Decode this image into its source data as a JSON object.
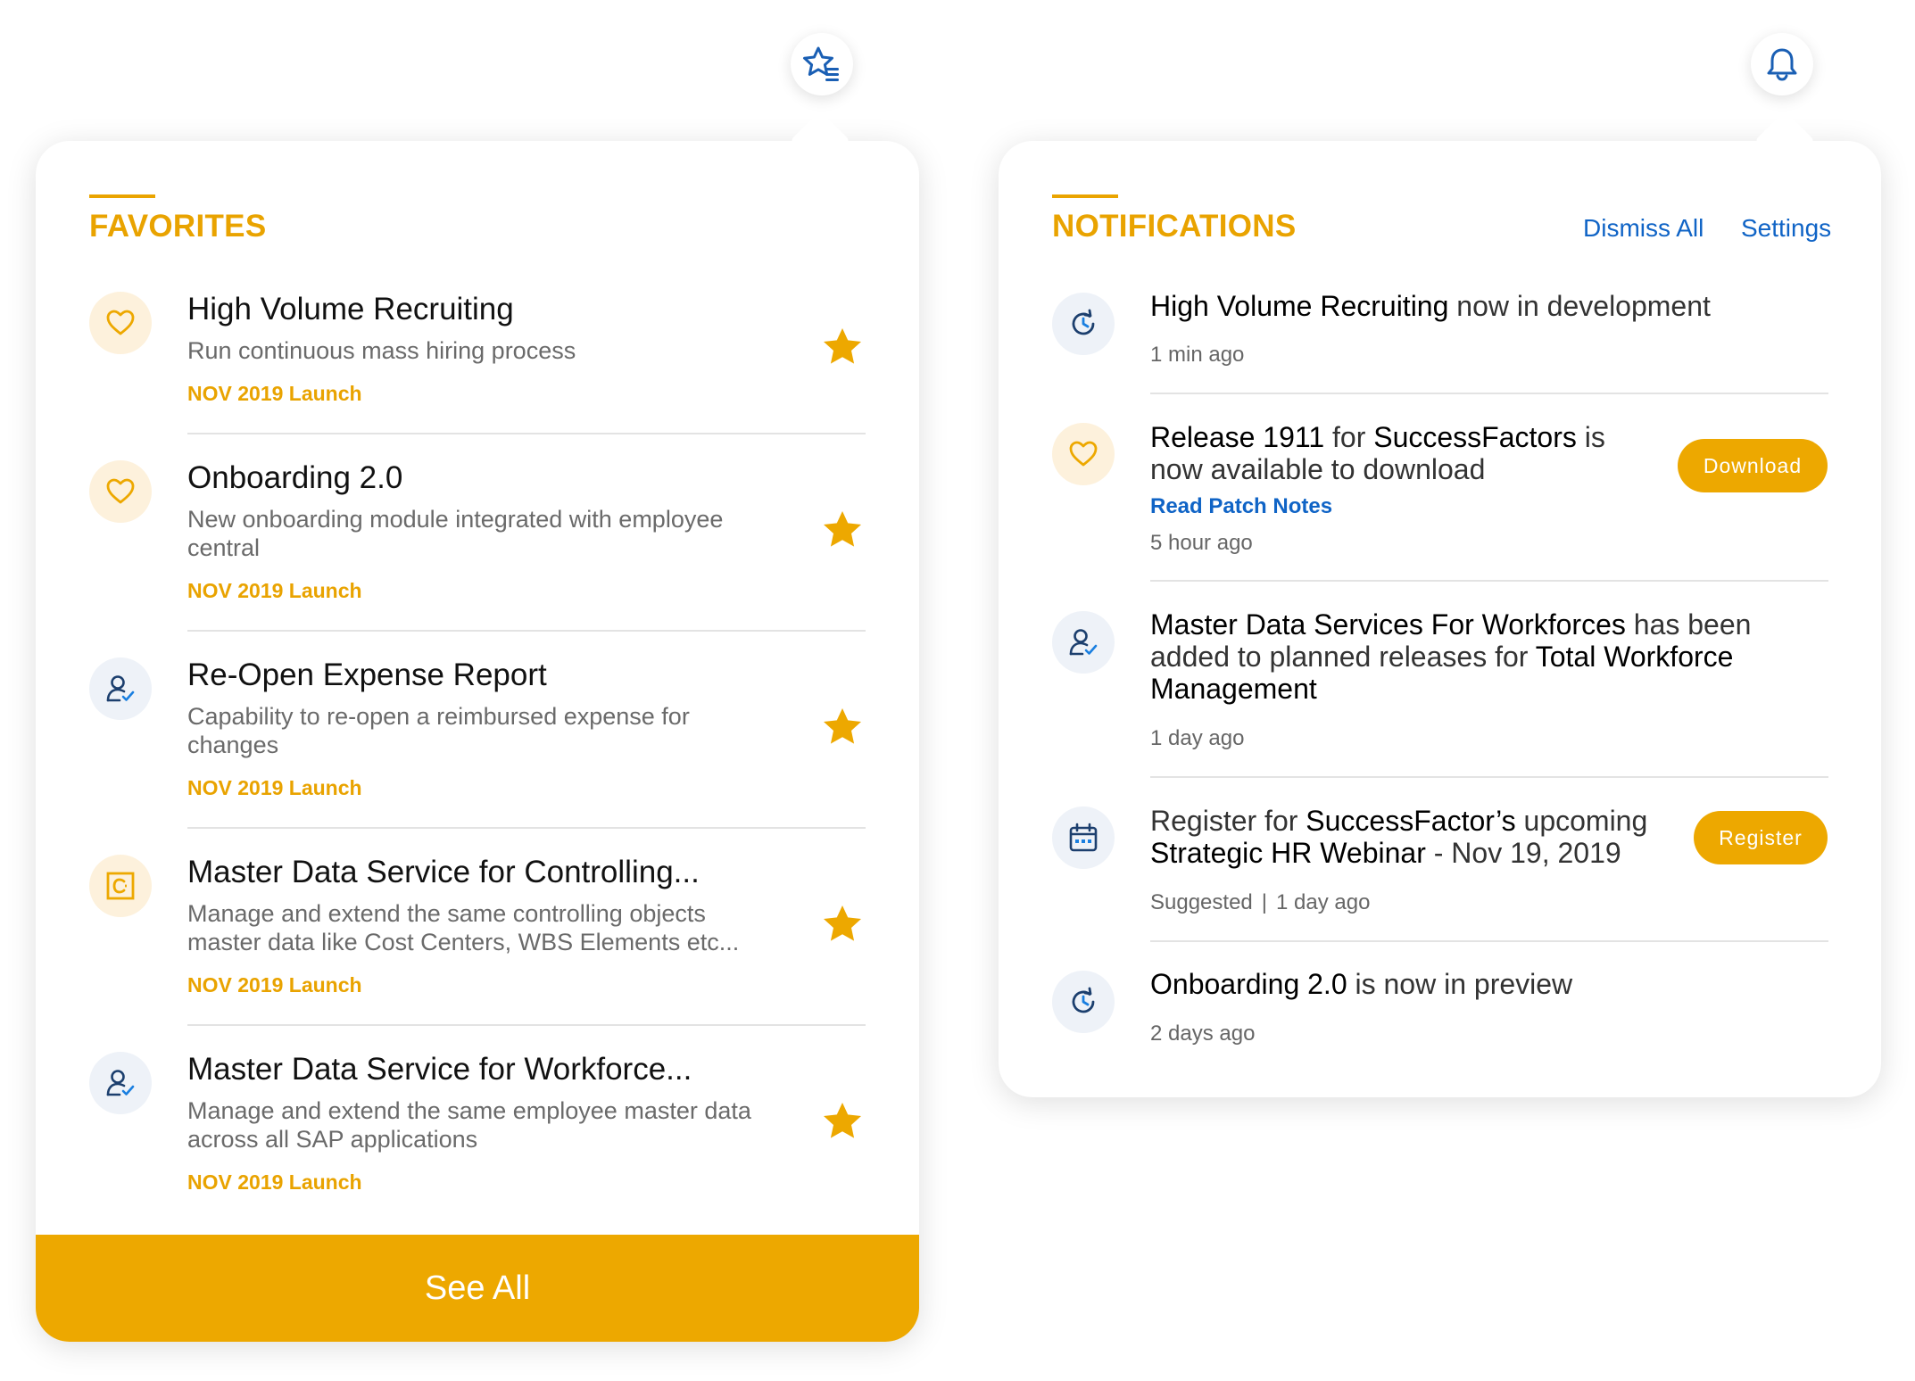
{
  "icons": {
    "favorites_toggle": "star-list-icon",
    "notifications_toggle": "bell-icon"
  },
  "colors": {
    "accent": "#eda800",
    "link": "#1064c6",
    "icon_blue": "#1a5fb4"
  },
  "favorites": {
    "title": "FAVORITES",
    "see_all": "See All",
    "items": [
      {
        "title": "High Volume Recruiting",
        "desc": "Run continuous mass hiring process",
        "launch": "NOV 2019 Launch",
        "icon": "heart-icon"
      },
      {
        "title": "Onboarding 2.0",
        "desc": "New onboarding module integrated with employee central",
        "launch": "NOV 2019 Launch",
        "icon": "heart-icon"
      },
      {
        "title": "Re-Open Expense Report",
        "desc": "Capability to re-open a reimbursed expense for changes",
        "launch": "NOV 2019 Launch",
        "icon": "user-check-icon"
      },
      {
        "title": "Master Data Service for Controlling...",
        "desc": "Manage and extend the same controlling objects master data like Cost Centers, WBS Elements etc...",
        "launch": "NOV 2019 Launch",
        "icon": "controlling-icon"
      },
      {
        "title": "Master Data Service for Workforce...",
        "desc": "Manage and extend the same employee master data across all SAP applications",
        "launch": "NOV 2019 Launch",
        "icon": "user-check-icon"
      }
    ]
  },
  "notifications": {
    "title": "NOTIFICATIONS",
    "dismiss_all": "Dismiss All",
    "settings": "Settings",
    "items": [
      {
        "strong1": "High Volume Recruiting",
        "text1": " now in development",
        "time": "1 min ago",
        "icon": "history-icon"
      },
      {
        "strong1": "Release 1911",
        "text1": " for ",
        "strong2": "SuccessFactors",
        "text2": " is now available to download",
        "link": "Read Patch Notes",
        "time": "5 hour ago",
        "button": "Download",
        "icon": "heart-icon"
      },
      {
        "strong1": "Master Data Services For Workforces",
        "text1": " has been added to planned releases for ",
        "strong2": "Total Workforce Management",
        "time": "1 day ago",
        "icon": "user-check-icon"
      },
      {
        "text0": "Register for ",
        "strong1": "SuccessFactor’s",
        "text1": " upcoming ",
        "strong2": "Strategic HR Webinar",
        "text2": " - Nov 19, 2019",
        "time_a": "Suggested",
        "sep": "|",
        "time": "1 day ago",
        "button": "Register",
        "icon": "calendar-icon"
      },
      {
        "strong1": "Onboarding 2.0",
        "text1": " is now in preview",
        "time": "2 days ago",
        "icon": "history-icon"
      }
    ]
  }
}
